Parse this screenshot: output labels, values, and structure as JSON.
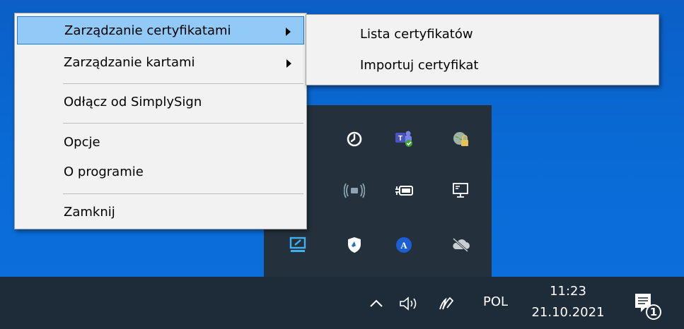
{
  "context_menu": {
    "items": [
      {
        "label": "Zarządzanie certyfikatami",
        "has_submenu": true,
        "highlighted": true
      },
      {
        "label": "Zarządzanie kartami",
        "has_submenu": true
      },
      {
        "label": "Odłącz od SimplySign"
      },
      {
        "label": "Opcje"
      },
      {
        "label": "O programie"
      },
      {
        "label": "Zamknij"
      }
    ]
  },
  "submenu": {
    "items": [
      {
        "label": "Lista certyfikatów"
      },
      {
        "label": "Importuj certyfikat"
      }
    ]
  },
  "tray_overflow": {
    "icons": [
      "power-timer-icon",
      "teams-icon",
      "network-lock-icon",
      "wireless-signal-icon",
      "battery-plug-icon",
      "monitor-network-icon",
      "display-icon",
      "shield-icon",
      "app-a-icon",
      "cloud-offline-icon"
    ]
  },
  "taskbar": {
    "chevron": "^",
    "input_language": "POL",
    "time": "11:23",
    "date": "21.10.2021",
    "notification_count": "1"
  },
  "colors": {
    "desktop": "#0a66cf",
    "menu_bg": "#f2f2f2",
    "highlight": "#91c9f7",
    "highlight_border": "#1f7ad1",
    "taskbar": "#1e2b38",
    "tray_flyout": "#24313d"
  }
}
